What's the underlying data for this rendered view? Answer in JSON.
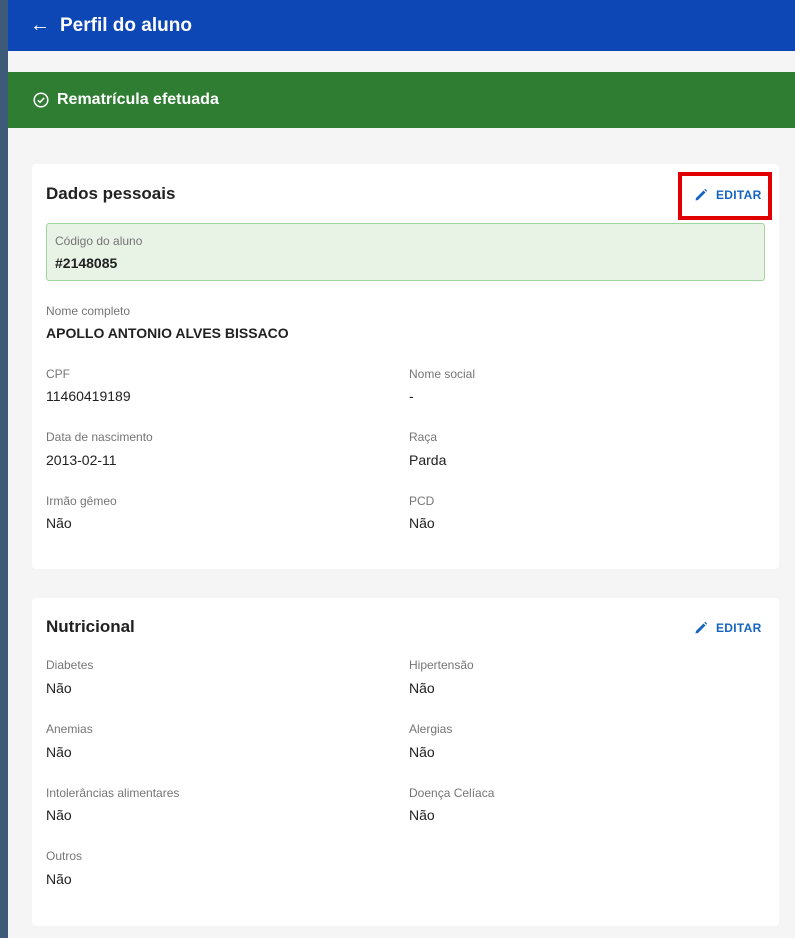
{
  "header": {
    "back_icon": "←",
    "title": "Perfil do aluno"
  },
  "banner": {
    "text": "Rematrícula efetuada",
    "color": "#2e7d32"
  },
  "personal": {
    "title": "Dados pessoais",
    "edit_label": "EDITAR",
    "code_label": "Código do aluno",
    "code_value": "#2148085",
    "fields": {
      "nome_label": "Nome completo",
      "nome_value": "APOLLO ANTONIO ALVES BISSACO",
      "cpf_label": "CPF",
      "cpf_value": "11460419189",
      "social_label": "Nome social",
      "social_value": "-",
      "nasc_label": "Data de nascimento",
      "nasc_value": "2013-02-11",
      "raca_label": "Raça",
      "raca_value": "Parda",
      "gemeo_label": "Irmão gêmeo",
      "gemeo_value": "Não",
      "pcd_label": "PCD",
      "pcd_value": "Não"
    }
  },
  "nutritional": {
    "title": "Nutricional",
    "edit_label": "EDITAR",
    "fields": {
      "diabetes_label": "Diabetes",
      "diabetes_value": "Não",
      "hiper_label": "Hipertensão",
      "hiper_value": "Não",
      "anemias_label": "Anemias",
      "anemias_value": "Não",
      "alergias_label": "Alergias",
      "alergias_value": "Não",
      "intol_label": "Intolerâncias alimentares",
      "intol_value": "Não",
      "celiaca_label": "Doença Celíaca",
      "celiaca_value": "Não",
      "outros_label": "Outros",
      "outros_value": "Não"
    }
  }
}
